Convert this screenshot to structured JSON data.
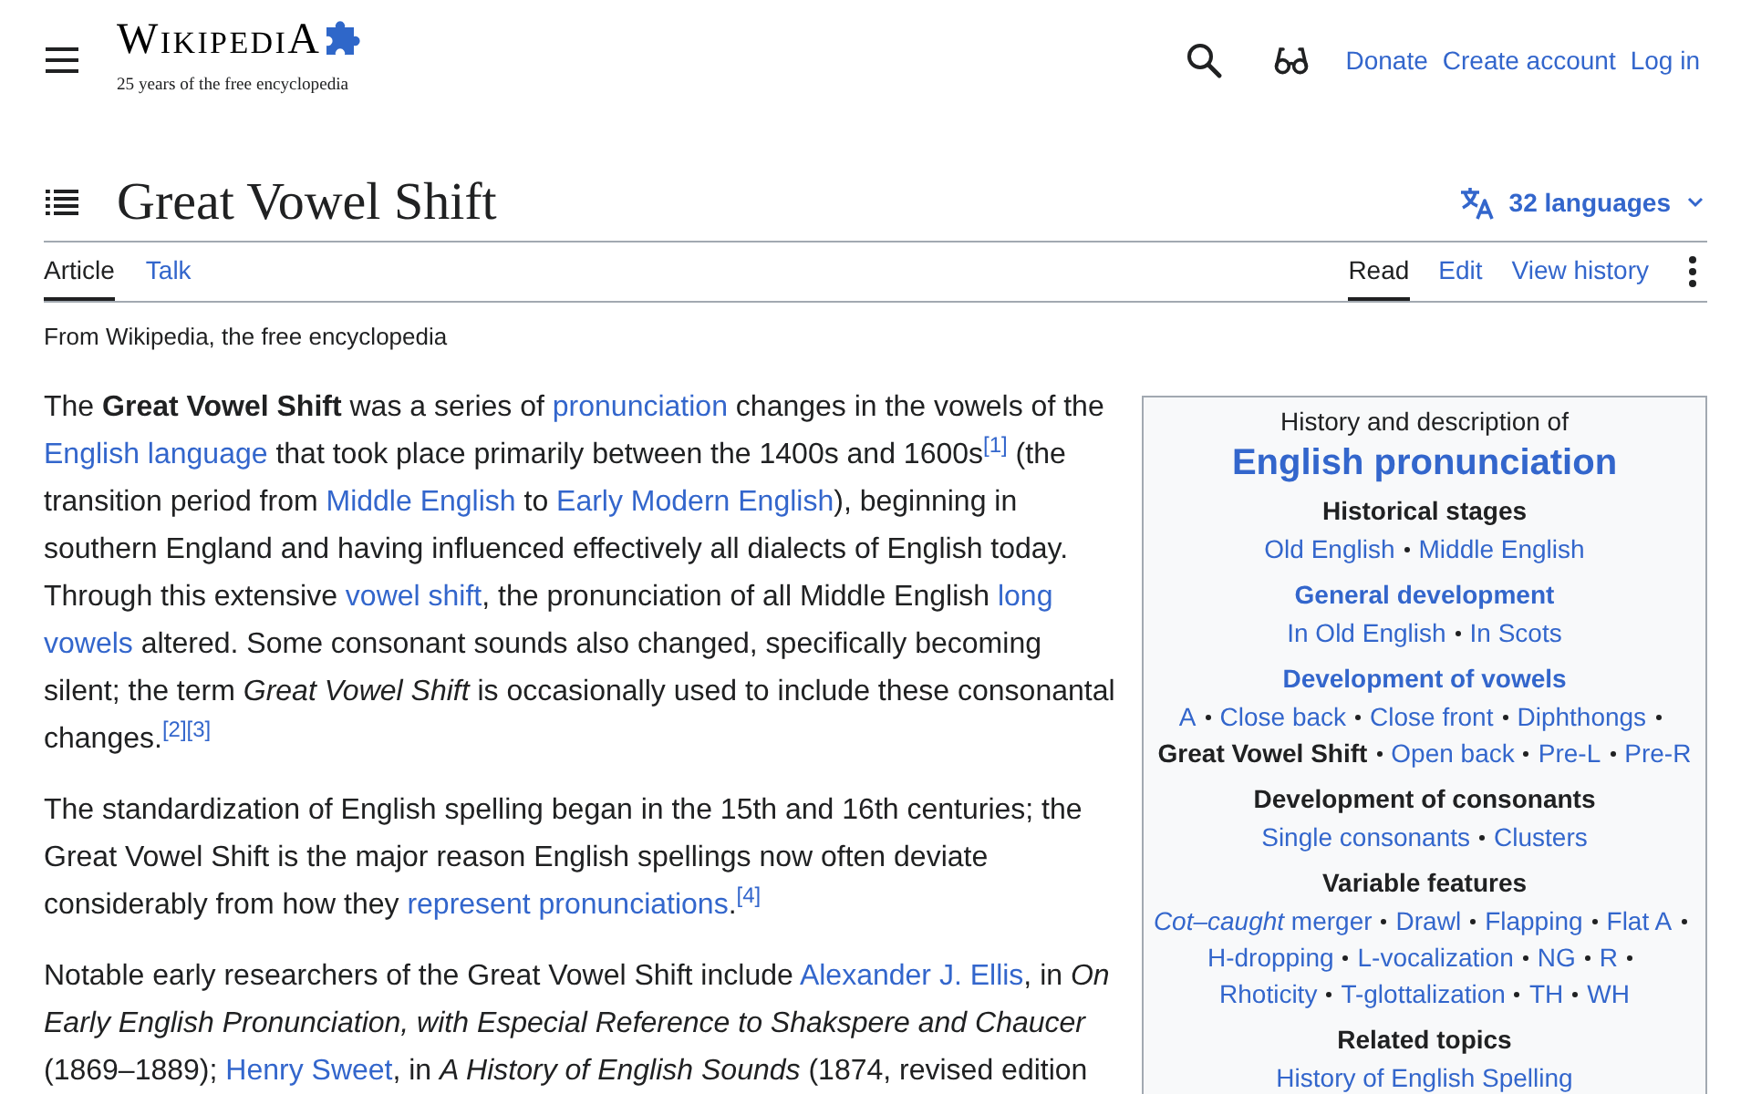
{
  "header": {
    "wordmark": "WikipediA",
    "tagline": "25 years of the free encyclopedia",
    "links": [
      "Donate",
      "Create account",
      "Log in"
    ]
  },
  "page": {
    "title": "Great Vowel Shift",
    "languages": "32 languages"
  },
  "namespace_tabs": [
    {
      "label": "Article",
      "selected": true
    },
    {
      "label": "Talk",
      "selected": false
    }
  ],
  "view_tabs": [
    {
      "label": "Read",
      "selected": true
    },
    {
      "label": "Edit",
      "selected": false
    },
    {
      "label": "View history",
      "selected": false
    }
  ],
  "subtitle": "From Wikipedia, the free encyclopedia",
  "paragraphs": [
    {
      "segments": [
        {
          "kind": "text",
          "text": "The **Great Vowel Shift** was a series of "
        },
        {
          "kind": "link",
          "text": "pronunciation"
        },
        {
          "kind": "text",
          "text": " changes in the vowels of the "
        },
        {
          "kind": "link",
          "text": "English language"
        },
        {
          "kind": "text",
          "text": " that took place primarily between the 1400s and 1600s"
        },
        {
          "kind": "ref",
          "text": "[1]"
        },
        {
          "kind": "text",
          "text": " (the transition period from "
        },
        {
          "kind": "link",
          "text": "Middle English"
        },
        {
          "kind": "text",
          "text": " to "
        },
        {
          "kind": "link",
          "text": "Early Modern English"
        },
        {
          "kind": "text",
          "text": "), beginning in southern England and having influenced effectively all dialects of English today. Through this extensive "
        },
        {
          "kind": "link",
          "text": "vowel shift"
        },
        {
          "kind": "text",
          "text": ", the pronunciation of all Middle English "
        },
        {
          "kind": "link",
          "text": "long"
        },
        {
          "kind": "link",
          "text": "vowels"
        },
        {
          "kind": "text",
          "text": " altered. Some consonant sounds also changed, specifically becoming silent; the term *Great Vowel Shift* is occasionally used to include these consonantal changes."
        },
        {
          "kind": "ref",
          "text": "[2]"
        },
        {
          "kind": "ref",
          "text": "[3]"
        }
      ]
    },
    {
      "segments": [
        {
          "kind": "text",
          "text": "The standardization of English spelling began in the 15th and 16th centuries; the Great Vowel Shift is the major reason English spellings now often deviate considerably from how they "
        },
        {
          "kind": "link",
          "text": "represent pronunciations"
        },
        {
          "kind": "text",
          "text": "."
        },
        {
          "kind": "ref",
          "text": "[4]"
        }
      ]
    },
    {
      "segments": [
        {
          "kind": "text",
          "text": "Notable early researchers of the Great Vowel Shift include "
        },
        {
          "kind": "link",
          "text": "Alexander J. Ellis"
        },
        {
          "kind": "text",
          "text": ", in *On Early English Pronunciation, with Especial Reference to Shakspere and Chaucer* (1869–1889); "
        },
        {
          "kind": "link",
          "text": "Henry Sweet"
        },
        {
          "kind": "text",
          "text": ", in *A History of English Sounds* (1874, revised edition"
        }
      ]
    }
  ],
  "infobox": {
    "above": "History and description of",
    "title": "English pronunciation",
    "groups": [
      {
        "heading": {
          "kind": "text",
          "text": "Historical stages"
        },
        "items": [
          {
            "kind": "link",
            "text": "Old English"
          },
          {
            "kind": "link",
            "text": "Middle English"
          }
        ]
      },
      {
        "heading": {
          "kind": "link",
          "text": "General development"
        },
        "items": [
          {
            "kind": "link",
            "text": "In Old English"
          },
          {
            "kind": "link",
            "text": "In Scots"
          }
        ]
      },
      {
        "heading": {
          "kind": "link",
          "text": "Development of vowels"
        },
        "items": [
          {
            "kind": "link",
            "text": "A"
          },
          {
            "kind": "link",
            "text": "Close back"
          },
          {
            "kind": "link",
            "text": "Close front"
          },
          {
            "kind": "link",
            "text": "Diphthongs"
          },
          {
            "kind": "current",
            "text": "Great Vowel Shift"
          },
          {
            "kind": "link",
            "text": "Open back"
          },
          {
            "kind": "link",
            "text": "Pre-L"
          },
          {
            "kind": "link",
            "text": "Pre-R"
          }
        ]
      },
      {
        "heading": {
          "kind": "text",
          "text": "Development of consonants"
        },
        "items": [
          {
            "kind": "link",
            "text": "Single consonants"
          },
          {
            "kind": "link",
            "text": "Clusters"
          }
        ]
      },
      {
        "heading": {
          "kind": "text",
          "text": "Variable features"
        },
        "items": [
          {
            "kind": "link",
            "text": "*Cot–caught* merger"
          },
          {
            "kind": "link",
            "text": "Drawl"
          },
          {
            "kind": "link",
            "text": "Flapping"
          },
          {
            "kind": "link",
            "text": "Flat A"
          },
          {
            "kind": "link",
            "text": "H-dropping"
          },
          {
            "kind": "link",
            "text": "L-vocalization"
          },
          {
            "kind": "link",
            "text": "NG"
          },
          {
            "kind": "link",
            "text": "R"
          },
          {
            "kind": "link",
            "text": "Rhoticity"
          },
          {
            "kind": "link",
            "text": "T-glottalization"
          },
          {
            "kind": "link",
            "text": "TH"
          },
          {
            "kind": "link",
            "text": "WH"
          }
        ]
      },
      {
        "heading": {
          "kind": "text",
          "text": "Related topics"
        },
        "items": [
          {
            "kind": "link",
            "text": "History of English Spelling"
          }
        ]
      }
    ]
  }
}
